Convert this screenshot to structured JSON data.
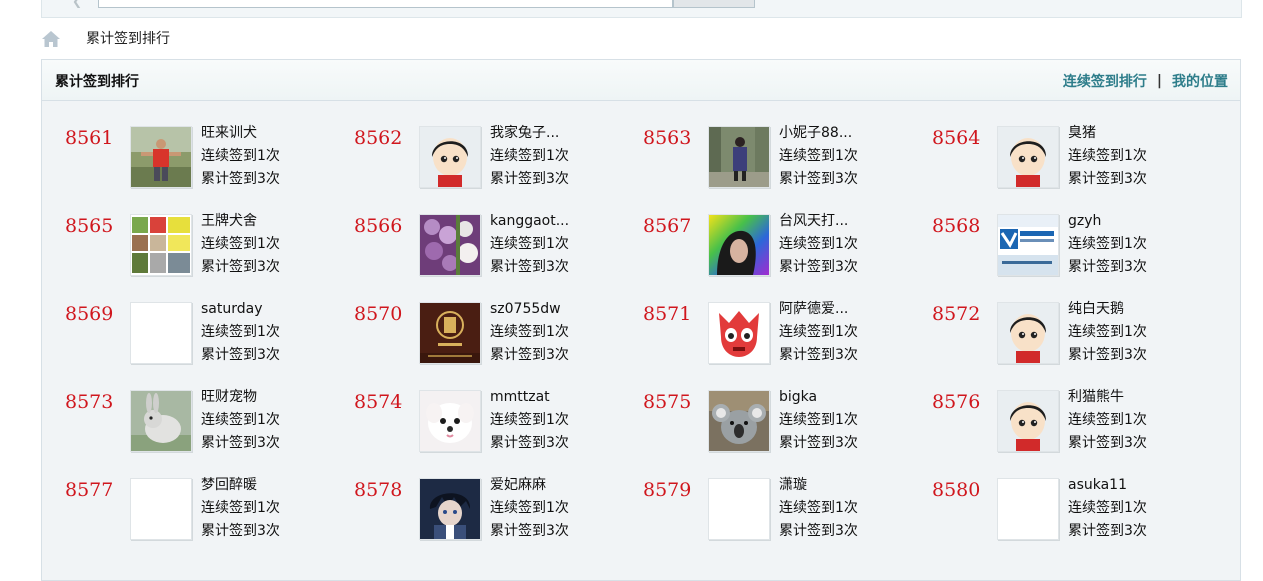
{
  "breadcrumb": {
    "title": "累计签到排行"
  },
  "panel": {
    "title": "累计签到排行",
    "link_continuous": "连续签到排行",
    "link_separator": "|",
    "link_my_position": "我的位置"
  },
  "entries": [
    {
      "rank": "8561",
      "name": "旺来训犬",
      "continuous": "连续签到1次",
      "total": "累计签到3次",
      "avatar": "photo-man-outdoor"
    },
    {
      "rank": "8562",
      "name": "我家兔子...",
      "continuous": "连续签到1次",
      "total": "累计签到3次",
      "avatar": "default-avatar"
    },
    {
      "rank": "8563",
      "name": "小妮子88...",
      "continuous": "连续签到1次",
      "total": "累计签到3次",
      "avatar": "photo-woman-forest"
    },
    {
      "rank": "8564",
      "name": "臭猪",
      "continuous": "连续签到1次",
      "total": "累计签到3次",
      "avatar": "default-avatar"
    },
    {
      "rank": "8565",
      "name": "王牌犬舍",
      "continuous": "连续签到1次",
      "total": "累计签到3次",
      "avatar": "photo-collage"
    },
    {
      "rank": "8566",
      "name": "kanggaot...",
      "continuous": "连续签到1次",
      "total": "累计签到3次",
      "avatar": "photo-flowers"
    },
    {
      "rank": "8567",
      "name": "台风天打...",
      "continuous": "连续签到1次",
      "total": "累计签到3次",
      "avatar": "photo-rainbow-girl"
    },
    {
      "rank": "8568",
      "name": "gzyh",
      "continuous": "连续签到1次",
      "total": "累计签到3次",
      "avatar": "photo-logo-banner"
    },
    {
      "rank": "8569",
      "name": "saturday",
      "continuous": "连续签到1次",
      "total": "累计签到3次",
      "avatar": "blank-avatar"
    },
    {
      "rank": "8570",
      "name": "sz0755dw",
      "continuous": "连续签到1次",
      "total": "累计签到3次",
      "avatar": "photo-brown-logo"
    },
    {
      "rank": "8571",
      "name": "阿萨德爱...",
      "continuous": "连续签到1次",
      "total": "累计签到3次",
      "avatar": "photo-red-cartoon"
    },
    {
      "rank": "8572",
      "name": "纯白天鹅",
      "continuous": "连续签到1次",
      "total": "累计签到3次",
      "avatar": "default-avatar"
    },
    {
      "rank": "8573",
      "name": "旺财宠物",
      "continuous": "连续签到1次",
      "total": "累计签到3次",
      "avatar": "photo-rabbit"
    },
    {
      "rank": "8574",
      "name": "mmttzat",
      "continuous": "连续签到1次",
      "total": "累计签到3次",
      "avatar": "photo-white-puppy"
    },
    {
      "rank": "8575",
      "name": "bigka",
      "continuous": "连续签到1次",
      "total": "累计签到3次",
      "avatar": "photo-koala"
    },
    {
      "rank": "8576",
      "name": "利猫熊牛",
      "continuous": "连续签到1次",
      "total": "累计签到3次",
      "avatar": "default-avatar"
    },
    {
      "rank": "8577",
      "name": "梦回醉暖",
      "continuous": "连续签到1次",
      "total": "累计签到3次",
      "avatar": "blank-avatar"
    },
    {
      "rank": "8578",
      "name": "爱妃麻麻",
      "continuous": "连续签到1次",
      "total": "累计签到3次",
      "avatar": "photo-anime-boy"
    },
    {
      "rank": "8579",
      "name": "潇璇",
      "continuous": "连续签到1次",
      "total": "累计签到3次",
      "avatar": "blank-avatar"
    },
    {
      "rank": "8580",
      "name": "asuka11",
      "continuous": "连续签到1次",
      "total": "累计签到3次",
      "avatar": "blank-avatar"
    }
  ],
  "colors": {
    "rank": "#d0161d",
    "link": "#2d7d8a",
    "panel_bg": "#f1f4f6"
  }
}
